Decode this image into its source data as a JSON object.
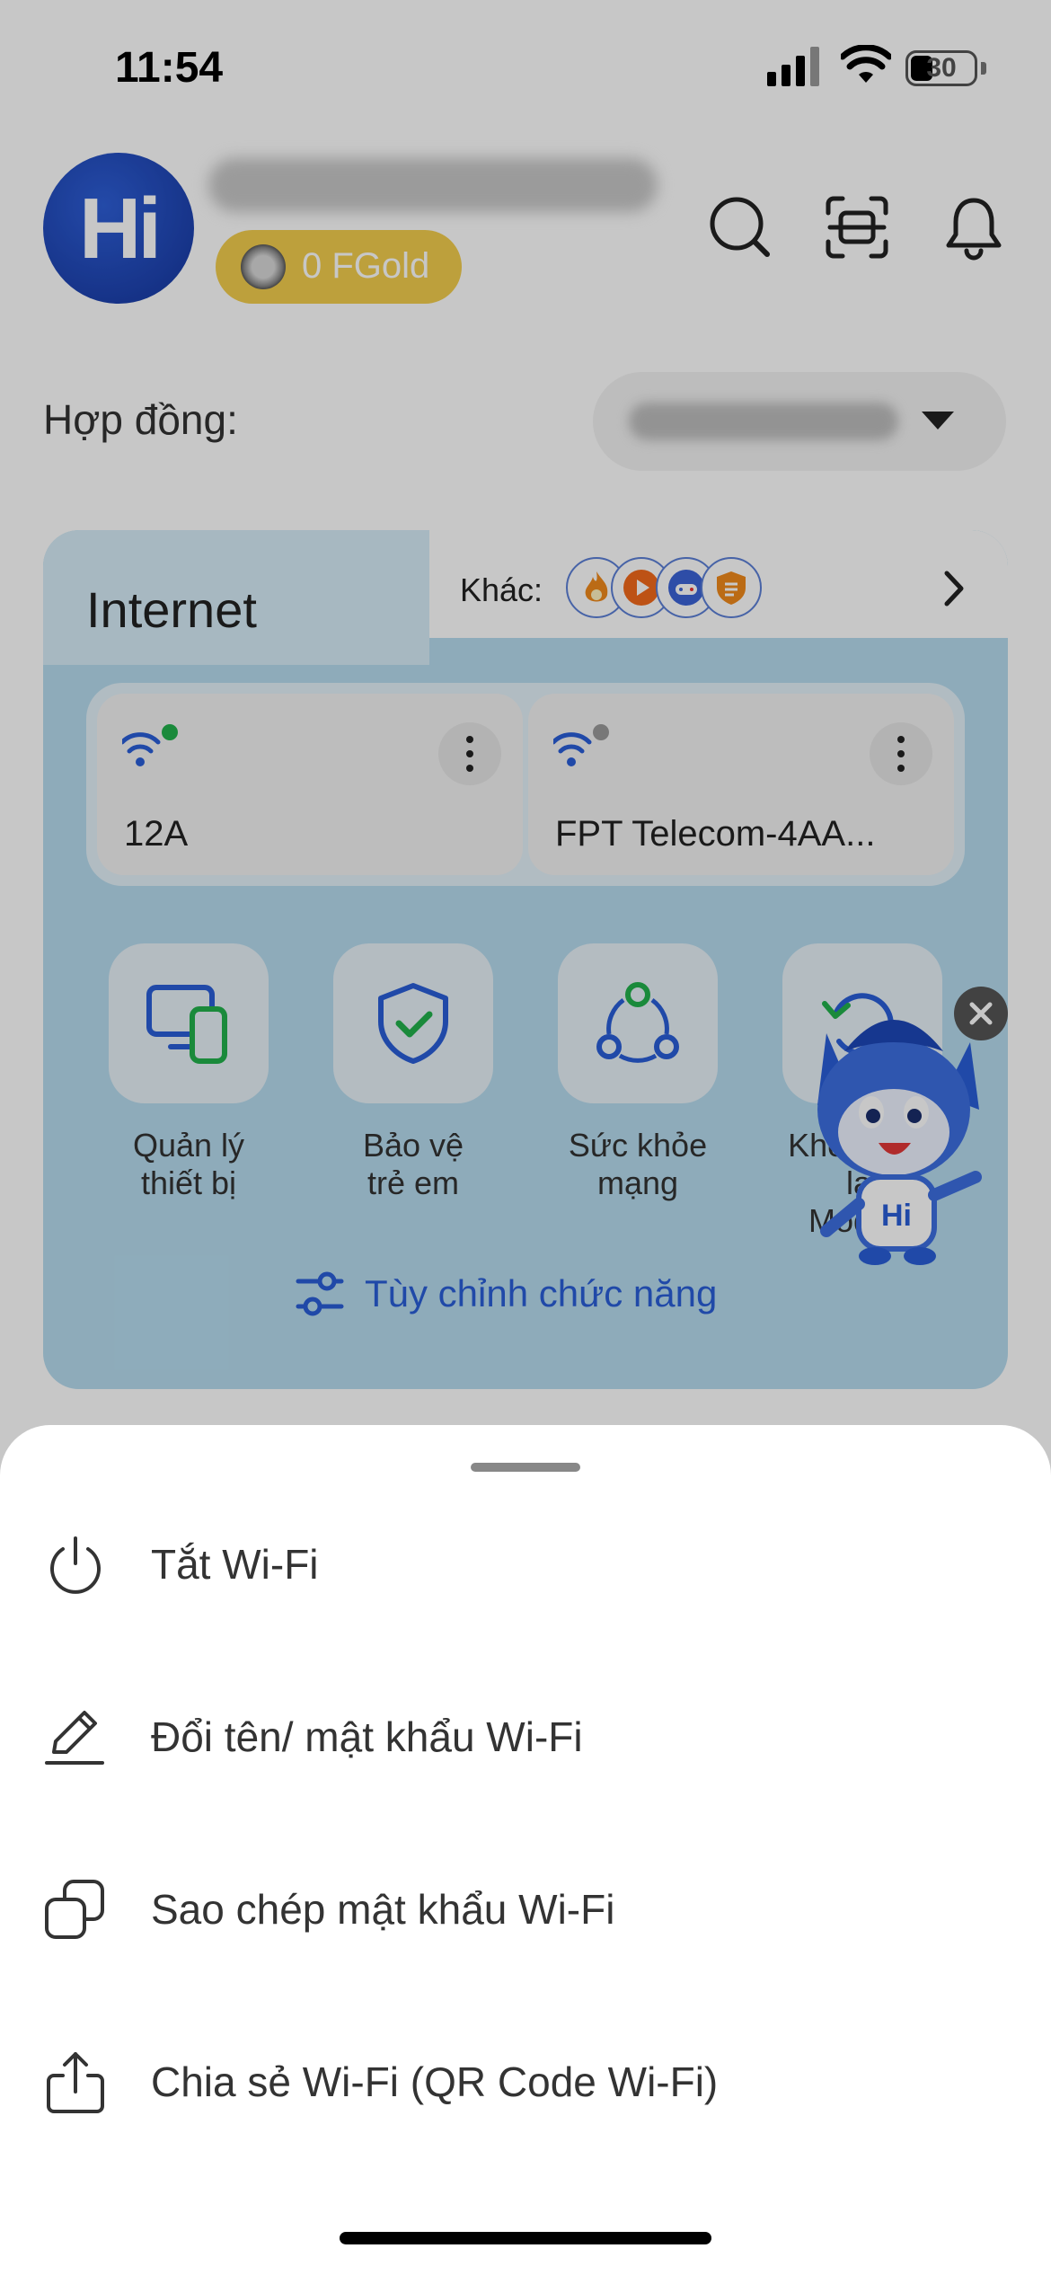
{
  "status_bar": {
    "time": "11:54",
    "battery": "30"
  },
  "header": {
    "avatar_text": "Hi",
    "gold_balance": "0 FGold",
    "contract_label": "Hợp đồng:"
  },
  "internet_card": {
    "title": "Internet",
    "other_label": "Khác:",
    "services": [
      "fire-icon",
      "play-icon",
      "game-icon",
      "shield-icon"
    ],
    "wifi_networks": [
      {
        "name": "12A",
        "status_color": "#22b14c"
      },
      {
        "name": "FPT Telecom-4AA...",
        "status_color": "#9a9a9a"
      }
    ],
    "features": [
      {
        "label_line1": "Quản lý",
        "label_line2": "thiết bị"
      },
      {
        "label_line1": "Bảo vệ",
        "label_line2": "trẻ em"
      },
      {
        "label_line1": "Sức khỏe",
        "label_line2": "mạng"
      },
      {
        "label_line1": "Khởi động lại",
        "label_line2": "Modem"
      }
    ],
    "customize_label": "Tùy chỉnh chức năng"
  },
  "mascot": {
    "badge_text": "Hi"
  },
  "bottom_sheet": {
    "items": [
      {
        "label": "Tắt Wi-Fi",
        "icon": "power-icon"
      },
      {
        "label": "Đổi tên/ mật khẩu Wi-Fi",
        "icon": "pencil-icon"
      },
      {
        "label": "Sao chép mật khẩu Wi-Fi",
        "icon": "copy-icon"
      },
      {
        "label": "Chia sẻ Wi-Fi (QR Code Wi-Fi)",
        "icon": "share-icon"
      }
    ]
  },
  "colors": {
    "brand_blue": "#2a5ed8",
    "gold": "#f3cd4e",
    "card_bg": "#b6dcef",
    "online_green": "#22b14c"
  }
}
